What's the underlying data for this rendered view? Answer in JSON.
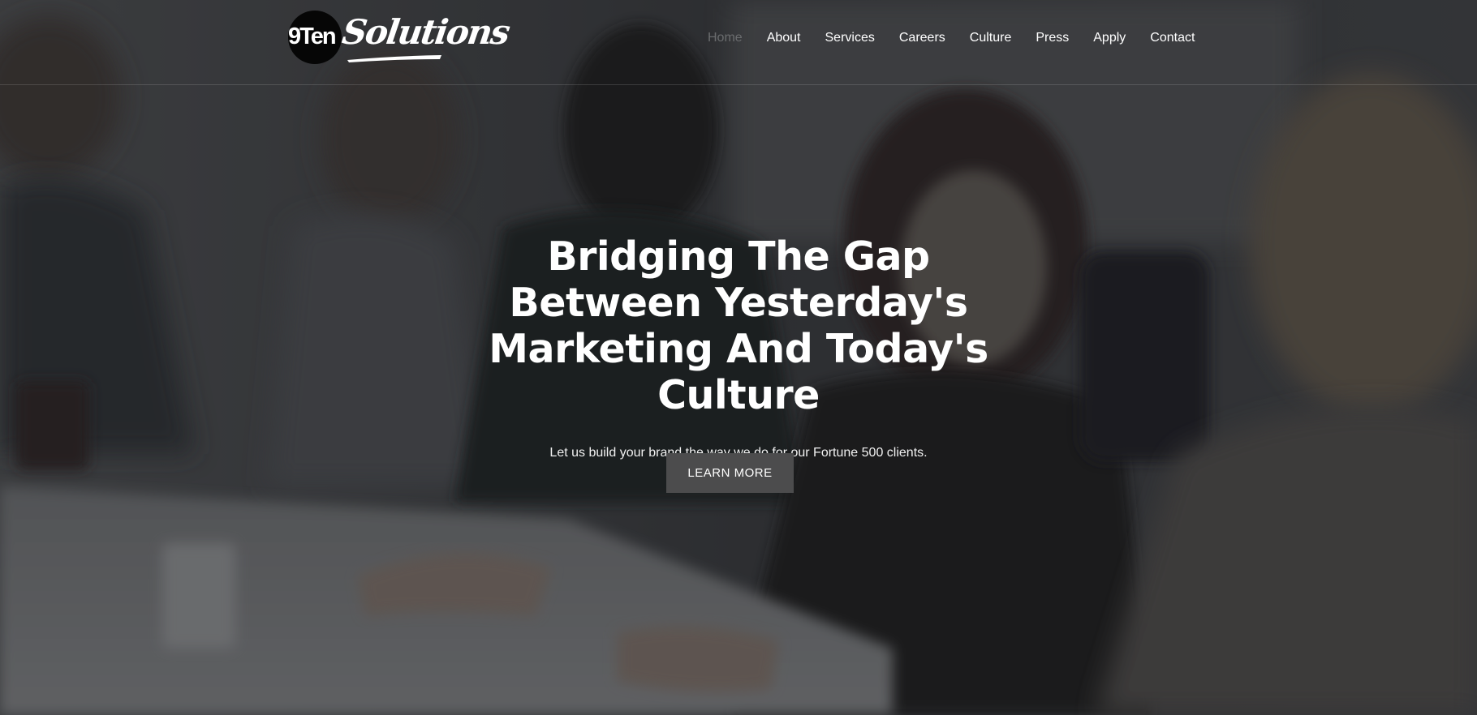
{
  "brand": {
    "logo_mark": "9Ten",
    "logo_wordmark": "Solutions"
  },
  "nav": {
    "items": [
      {
        "label": "Home",
        "active": true
      },
      {
        "label": "About",
        "active": false
      },
      {
        "label": "Services",
        "active": false
      },
      {
        "label": "Careers",
        "active": false
      },
      {
        "label": "Culture",
        "active": false
      },
      {
        "label": "Press",
        "active": false
      },
      {
        "label": "Apply",
        "active": false
      },
      {
        "label": "Contact",
        "active": false
      }
    ]
  },
  "hero": {
    "headline": "Bridging The Gap Between Yesterday's Marketing And Today's Culture",
    "subheadline": "Let us build your brand the way we do for our Fortune 500 clients.",
    "cta_label": "LEARN MORE",
    "background": "blurred photo of business people in a meeting"
  },
  "colors": {
    "overlay": "#2e3032",
    "nav_text": "#ffffff",
    "nav_active": "#6a6c6e",
    "cta_background": "#4c4c4d",
    "text": "#ffffff"
  }
}
